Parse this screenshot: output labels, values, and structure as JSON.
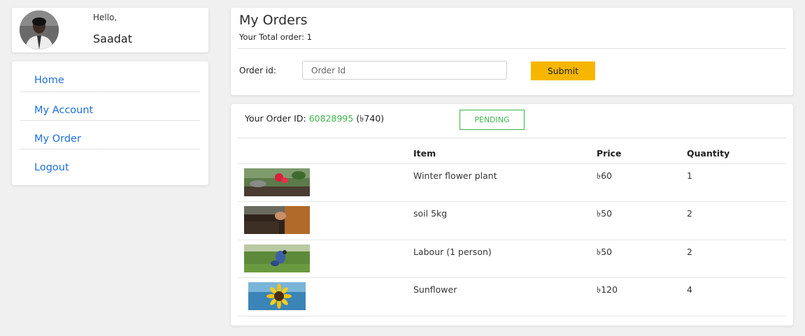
{
  "profile": {
    "greeting": "Hello,",
    "name": "Saadat",
    "avatar_icon": "user-avatar-icon"
  },
  "nav": {
    "items": [
      {
        "label": "Home"
      },
      {
        "label": "My Account"
      },
      {
        "label": "My Order"
      },
      {
        "label": "Logout"
      }
    ]
  },
  "orders": {
    "title": "My Orders",
    "total_label": "Your Total order: 1",
    "order_id_label": "Order id:",
    "order_id_placeholder": "Order Id",
    "order_id_value": "",
    "submit_label": "Submit"
  },
  "order_detail": {
    "order_id_prefix": "Your Order ID:",
    "order_id": "60828995",
    "amount": "(৳740)",
    "status": "PENDING",
    "columns": [
      "",
      "Item",
      "Price",
      "Quantity"
    ],
    "rows": [
      {
        "item": "Winter flower plant",
        "price": "৳60",
        "quantity": "1",
        "thumb": "flower-plant-photo"
      },
      {
        "item": "soil 5kg",
        "price": "৳50",
        "quantity": "2",
        "thumb": "soil-photo"
      },
      {
        "item": "Labour (1 person)",
        "price": "৳50",
        "quantity": "2",
        "thumb": "labour-photo"
      },
      {
        "item": "Sunflower",
        "price": "৳120",
        "quantity": "4",
        "thumb": "sunflower-photo"
      }
    ]
  },
  "colors": {
    "link": "#1e6fd9",
    "accent_green": "#3cb54a",
    "submit_bg": "#f6b600",
    "page_bg": "#f0f0f0"
  }
}
